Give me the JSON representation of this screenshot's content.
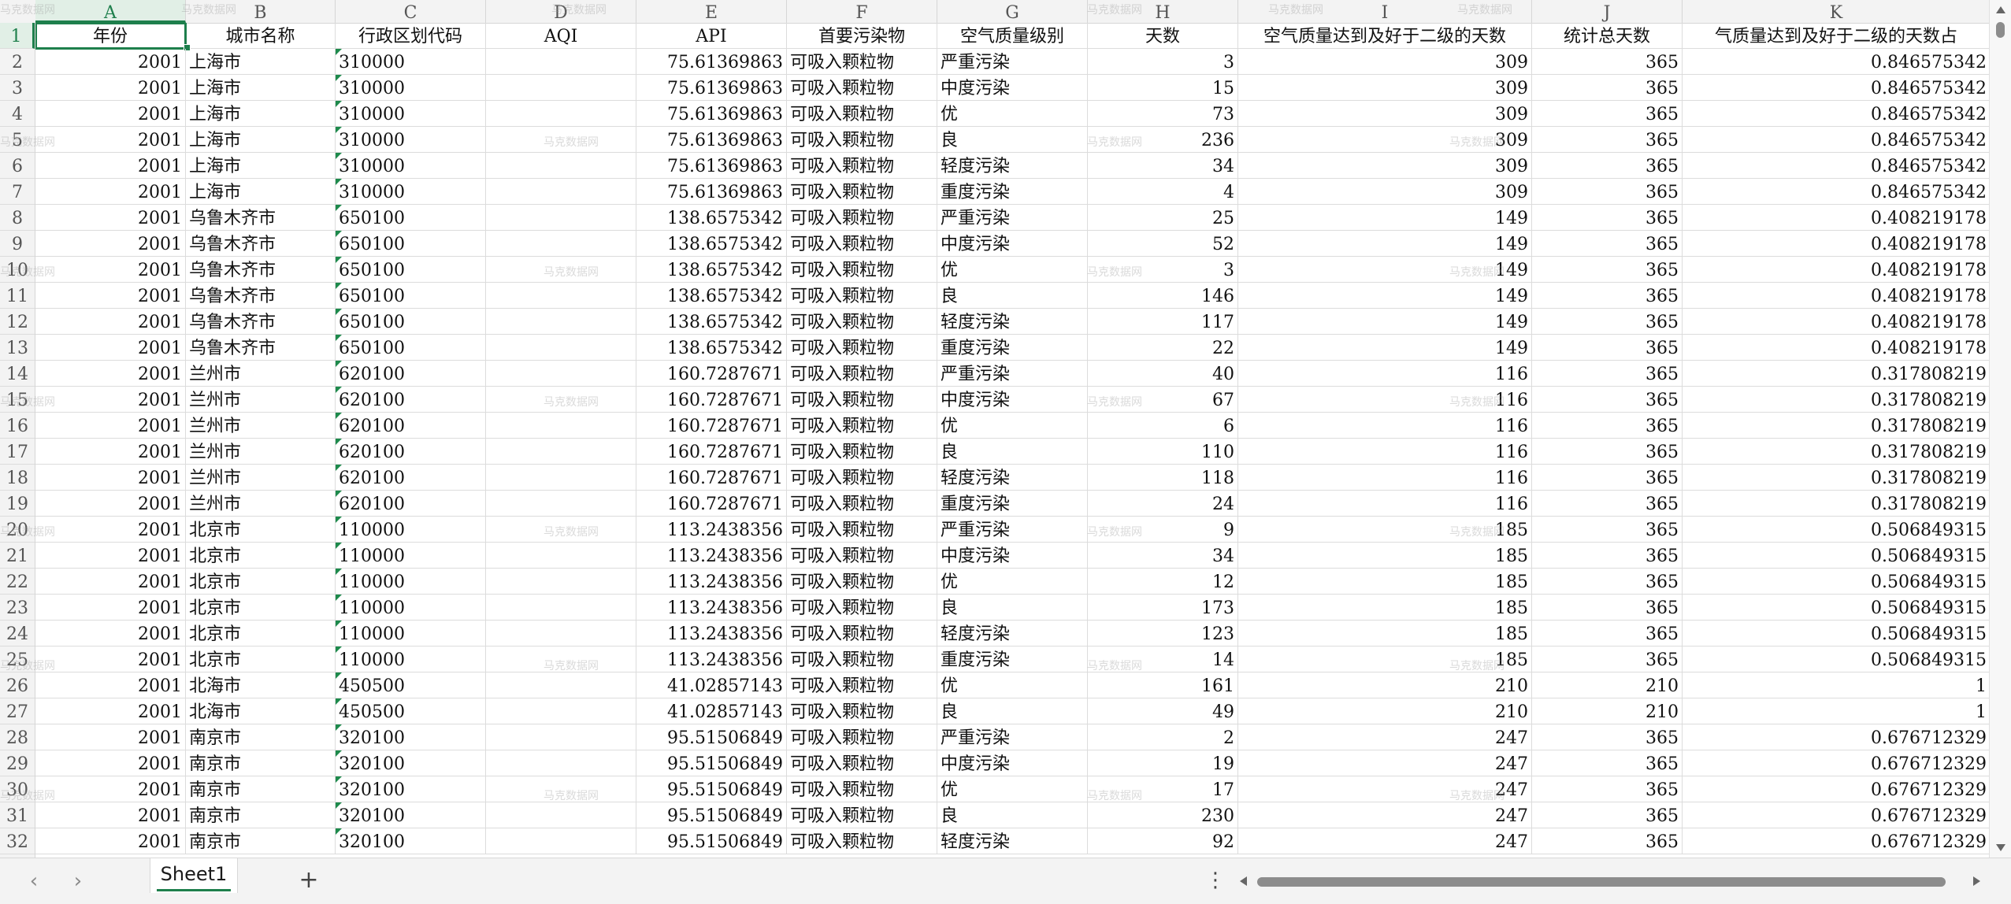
{
  "columns": [
    "A",
    "B",
    "C",
    "D",
    "E",
    "F",
    "G",
    "H",
    "I",
    "J",
    "K"
  ],
  "header_row": [
    "年份",
    "城市名称",
    "行政区划代码",
    "AQI",
    "API",
    "首要污染物",
    "空气质量级别",
    "天数",
    "空气质量达到及好于二级的天数",
    "统计总天数",
    "气质量达到及好于二级的天数占"
  ],
  "rows": [
    {
      "n": "2",
      "c": [
        "2001",
        "上海市",
        "310000",
        "",
        "75.61369863",
        "可吸入颗粒物",
        "严重污染",
        "3",
        "309",
        "365",
        "0.846575342"
      ]
    },
    {
      "n": "3",
      "c": [
        "2001",
        "上海市",
        "310000",
        "",
        "75.61369863",
        "可吸入颗粒物",
        "中度污染",
        "15",
        "309",
        "365",
        "0.846575342"
      ]
    },
    {
      "n": "4",
      "c": [
        "2001",
        "上海市",
        "310000",
        "",
        "75.61369863",
        "可吸入颗粒物",
        "优",
        "73",
        "309",
        "365",
        "0.846575342"
      ]
    },
    {
      "n": "5",
      "c": [
        "2001",
        "上海市",
        "310000",
        "",
        "75.61369863",
        "可吸入颗粒物",
        "良",
        "236",
        "309",
        "365",
        "0.846575342"
      ]
    },
    {
      "n": "6",
      "c": [
        "2001",
        "上海市",
        "310000",
        "",
        "75.61369863",
        "可吸入颗粒物",
        "轻度污染",
        "34",
        "309",
        "365",
        "0.846575342"
      ]
    },
    {
      "n": "7",
      "c": [
        "2001",
        "上海市",
        "310000",
        "",
        "75.61369863",
        "可吸入颗粒物",
        "重度污染",
        "4",
        "309",
        "365",
        "0.846575342"
      ]
    },
    {
      "n": "8",
      "c": [
        "2001",
        "乌鲁木齐市",
        "650100",
        "",
        "138.6575342",
        "可吸入颗粒物",
        "严重污染",
        "25",
        "149",
        "365",
        "0.408219178"
      ]
    },
    {
      "n": "9",
      "c": [
        "2001",
        "乌鲁木齐市",
        "650100",
        "",
        "138.6575342",
        "可吸入颗粒物",
        "中度污染",
        "52",
        "149",
        "365",
        "0.408219178"
      ]
    },
    {
      "n": "10",
      "c": [
        "2001",
        "乌鲁木齐市",
        "650100",
        "",
        "138.6575342",
        "可吸入颗粒物",
        "优",
        "3",
        "149",
        "365",
        "0.408219178"
      ]
    },
    {
      "n": "11",
      "c": [
        "2001",
        "乌鲁木齐市",
        "650100",
        "",
        "138.6575342",
        "可吸入颗粒物",
        "良",
        "146",
        "149",
        "365",
        "0.408219178"
      ]
    },
    {
      "n": "12",
      "c": [
        "2001",
        "乌鲁木齐市",
        "650100",
        "",
        "138.6575342",
        "可吸入颗粒物",
        "轻度污染",
        "117",
        "149",
        "365",
        "0.408219178"
      ]
    },
    {
      "n": "13",
      "c": [
        "2001",
        "乌鲁木齐市",
        "650100",
        "",
        "138.6575342",
        "可吸入颗粒物",
        "重度污染",
        "22",
        "149",
        "365",
        "0.408219178"
      ]
    },
    {
      "n": "14",
      "c": [
        "2001",
        "兰州市",
        "620100",
        "",
        "160.7287671",
        "可吸入颗粒物",
        "严重污染",
        "40",
        "116",
        "365",
        "0.317808219"
      ]
    },
    {
      "n": "15",
      "c": [
        "2001",
        "兰州市",
        "620100",
        "",
        "160.7287671",
        "可吸入颗粒物",
        "中度污染",
        "67",
        "116",
        "365",
        "0.317808219"
      ]
    },
    {
      "n": "16",
      "c": [
        "2001",
        "兰州市",
        "620100",
        "",
        "160.7287671",
        "可吸入颗粒物",
        "优",
        "6",
        "116",
        "365",
        "0.317808219"
      ]
    },
    {
      "n": "17",
      "c": [
        "2001",
        "兰州市",
        "620100",
        "",
        "160.7287671",
        "可吸入颗粒物",
        "良",
        "110",
        "116",
        "365",
        "0.317808219"
      ]
    },
    {
      "n": "18",
      "c": [
        "2001",
        "兰州市",
        "620100",
        "",
        "160.7287671",
        "可吸入颗粒物",
        "轻度污染",
        "118",
        "116",
        "365",
        "0.317808219"
      ]
    },
    {
      "n": "19",
      "c": [
        "2001",
        "兰州市",
        "620100",
        "",
        "160.7287671",
        "可吸入颗粒物",
        "重度污染",
        "24",
        "116",
        "365",
        "0.317808219"
      ]
    },
    {
      "n": "20",
      "c": [
        "2001",
        "北京市",
        "110000",
        "",
        "113.2438356",
        "可吸入颗粒物",
        "严重污染",
        "9",
        "185",
        "365",
        "0.506849315"
      ]
    },
    {
      "n": "21",
      "c": [
        "2001",
        "北京市",
        "110000",
        "",
        "113.2438356",
        "可吸入颗粒物",
        "中度污染",
        "34",
        "185",
        "365",
        "0.506849315"
      ]
    },
    {
      "n": "22",
      "c": [
        "2001",
        "北京市",
        "110000",
        "",
        "113.2438356",
        "可吸入颗粒物",
        "优",
        "12",
        "185",
        "365",
        "0.506849315"
      ]
    },
    {
      "n": "23",
      "c": [
        "2001",
        "北京市",
        "110000",
        "",
        "113.2438356",
        "可吸入颗粒物",
        "良",
        "173",
        "185",
        "365",
        "0.506849315"
      ]
    },
    {
      "n": "24",
      "c": [
        "2001",
        "北京市",
        "110000",
        "",
        "113.2438356",
        "可吸入颗粒物",
        "轻度污染",
        "123",
        "185",
        "365",
        "0.506849315"
      ]
    },
    {
      "n": "25",
      "c": [
        "2001",
        "北京市",
        "110000",
        "",
        "113.2438356",
        "可吸入颗粒物",
        "重度污染",
        "14",
        "185",
        "365",
        "0.506849315"
      ]
    },
    {
      "n": "26",
      "c": [
        "2001",
        "北海市",
        "450500",
        "",
        "41.02857143",
        "可吸入颗粒物",
        "优",
        "161",
        "210",
        "210",
        "1"
      ]
    },
    {
      "n": "27",
      "c": [
        "2001",
        "北海市",
        "450500",
        "",
        "41.02857143",
        "可吸入颗粒物",
        "良",
        "49",
        "210",
        "210",
        "1"
      ]
    },
    {
      "n": "28",
      "c": [
        "2001",
        "南京市",
        "320100",
        "",
        "95.51506849",
        "可吸入颗粒物",
        "严重污染",
        "2",
        "247",
        "365",
        "0.676712329"
      ]
    },
    {
      "n": "29",
      "c": [
        "2001",
        "南京市",
        "320100",
        "",
        "95.51506849",
        "可吸入颗粒物",
        "中度污染",
        "19",
        "247",
        "365",
        "0.676712329"
      ]
    },
    {
      "n": "30",
      "c": [
        "2001",
        "南京市",
        "320100",
        "",
        "95.51506849",
        "可吸入颗粒物",
        "优",
        "17",
        "247",
        "365",
        "0.676712329"
      ]
    },
    {
      "n": "31",
      "c": [
        "2001",
        "南京市",
        "320100",
        "",
        "95.51506849",
        "可吸入颗粒物",
        "良",
        "230",
        "247",
        "365",
        "0.676712329"
      ]
    },
    {
      "n": "32",
      "c": [
        "2001",
        "南京市",
        "320100",
        "",
        "95.51506849",
        "可吸入颗粒物",
        "轻度污染",
        "92",
        "247",
        "365",
        "0.676712329"
      ]
    }
  ],
  "watermark_text": "马克数据网",
  "active_cell": "A1",
  "tabbar": {
    "prev_icon": "chevron-left-icon",
    "next_icon": "chevron-right-icon",
    "sheet_tab": "Sheet1",
    "add_icon": "plus-icon",
    "more_icon": "more-vertical-icon"
  },
  "colors": {
    "accent": "#1e7f4c",
    "grid_line": "#dcdcdc",
    "header_bg": "#f3f3f3"
  }
}
